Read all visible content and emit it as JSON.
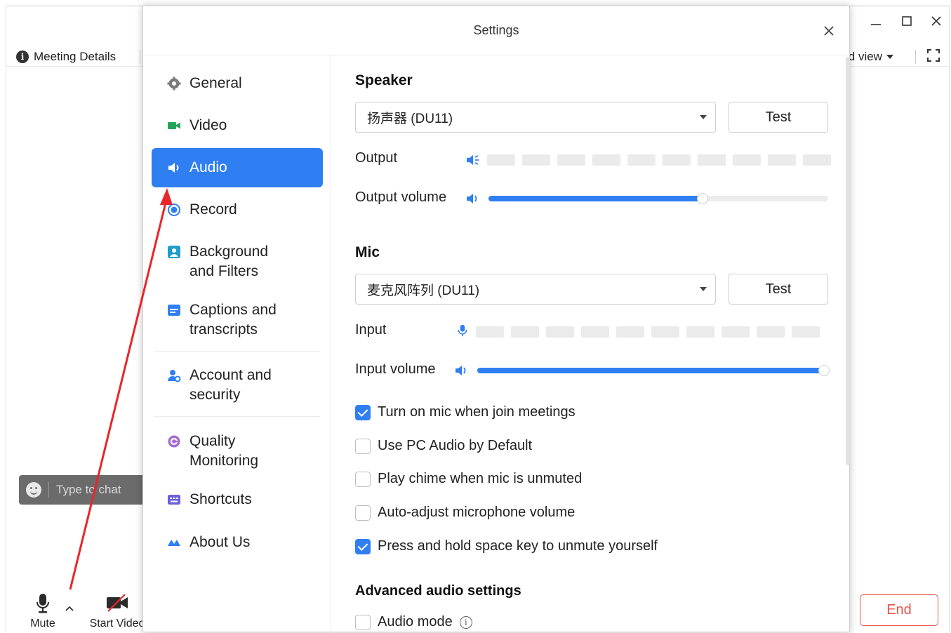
{
  "meeting": {
    "details_label": "Meeting Details",
    "view_label": "id view",
    "chat_placeholder": "Type to chat",
    "mute_label": "Mute",
    "start_video_label": "Start Video",
    "end_label": "End"
  },
  "dialog": {
    "title": "Settings"
  },
  "sidebar": {
    "items": [
      {
        "label": "General",
        "icon": "gear-icon"
      },
      {
        "label": "Video",
        "icon": "video-camera-icon"
      },
      {
        "label": "Audio",
        "icon": "speaker-icon",
        "active": true
      },
      {
        "label": "Record",
        "icon": "record-icon"
      },
      {
        "label": "Background and Filters",
        "line1": "Background",
        "line2": "and Filters",
        "icon": "background-icon"
      },
      {
        "label": "Captions and transcripts",
        "line1": "Captions and",
        "line2": "transcripts",
        "icon": "captions-icon"
      },
      {
        "label": "Account and security",
        "line1": "Account and",
        "line2": "security",
        "icon": "account-security-icon"
      },
      {
        "label": "Quality Monitoring",
        "line1": "Quality",
        "line2": "Monitoring",
        "icon": "quality-icon"
      },
      {
        "label": "Shortcuts",
        "icon": "keyboard-icon"
      },
      {
        "label": "About Us",
        "icon": "about-icon"
      }
    ]
  },
  "speaker": {
    "title": "Speaker",
    "device": "扬声器 (DU11)",
    "test_label": "Test",
    "output_label": "Output",
    "output_volume_label": "Output volume",
    "output_volume": 0.63
  },
  "mic": {
    "title": "Mic",
    "device": "麦克风阵列 (DU11)",
    "test_label": "Test",
    "input_label": "Input",
    "input_volume_label": "Input volume",
    "input_volume": 1.0
  },
  "options": [
    {
      "label": "Turn on mic when join meetings",
      "checked": true
    },
    {
      "label": "Use PC Audio by Default",
      "checked": false
    },
    {
      "label": "Play chime when mic is unmuted",
      "checked": false
    },
    {
      "label": "Auto-adjust microphone volume",
      "checked": false
    },
    {
      "label": "Press and hold space key to unmute yourself",
      "checked": true
    }
  ],
  "advanced": {
    "title": "Advanced audio settings",
    "audio_mode_label": "Audio mode",
    "audio_mode_checked": false
  },
  "colors": {
    "accent": "#2f7ff2",
    "end": "#e8534a",
    "annotation": "#e8262b"
  }
}
